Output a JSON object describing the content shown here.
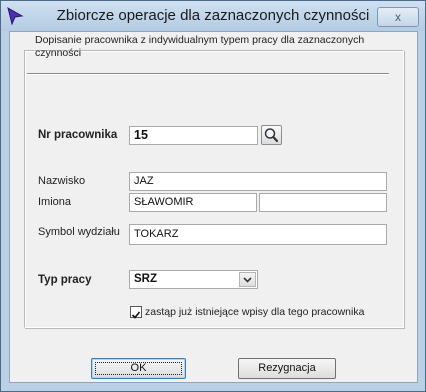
{
  "window": {
    "title": "Zbiorcze operacje dla zaznaczonych czynności",
    "close_symbol": "x"
  },
  "form": {
    "description": "Dopisanie pracownika z indywidualnym typem pracy dla zaznaczonych czynności",
    "employee_no": {
      "label": "Nr pracownika",
      "value": "15"
    },
    "surname": {
      "label": "Nazwisko",
      "value": "JAZ"
    },
    "first_names": {
      "label": "Imiona",
      "value": "SŁAWOMIR",
      "value2": ""
    },
    "department": {
      "label": "Symbol wydziału",
      "value": "TOKARZ"
    },
    "work_type": {
      "label": "Typ pracy",
      "value": "SRZ"
    },
    "replace_checkbox": {
      "label": "zastąp już istniejące wpisy dla tego pracownika",
      "checked": true
    }
  },
  "buttons": {
    "ok": "OK",
    "cancel": "Rezygnacja"
  },
  "icons": {
    "app": "arrow-cursor-icon",
    "search": "magnifier-icon"
  }
}
